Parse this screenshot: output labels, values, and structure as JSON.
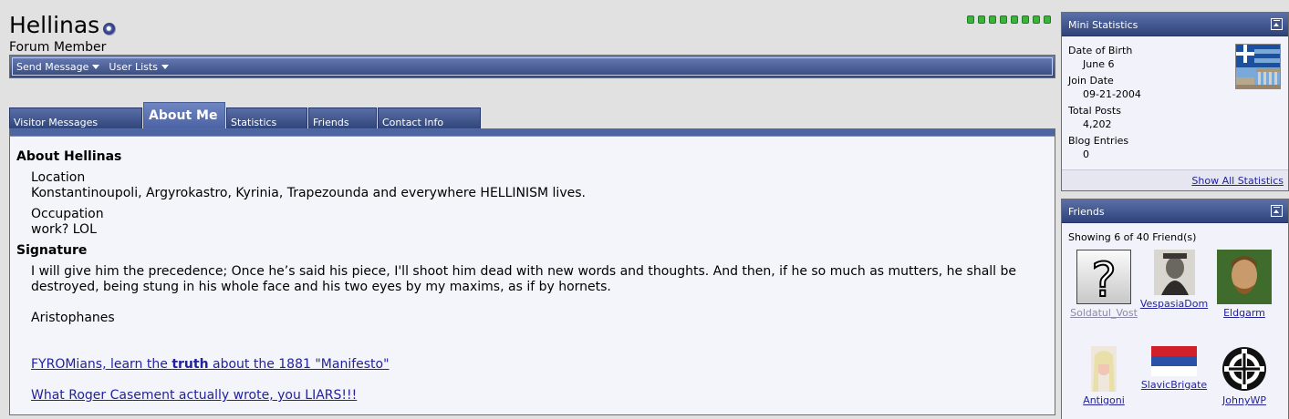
{
  "profile": {
    "username": "Hellinas",
    "usertitle": "Forum Member",
    "status_icon": "online-status-icon",
    "reputation_pips": 8
  },
  "actions": {
    "send_message": "Send Message",
    "user_lists": "User Lists"
  },
  "tabs": [
    "Visitor Messages",
    "About Me",
    "Statistics",
    "Friends",
    "Contact Info"
  ],
  "active_tab": "About Me",
  "about": {
    "title": "About Hellinas",
    "location_label": "Location",
    "location_value": "Konstantinoupoli, Argyrokastro, Kyrinia, Trapezounda and everywhere HELLINISM lives.",
    "occupation_label": "Occupation",
    "occupation_value": "work? LOL",
    "signature_title": "Signature",
    "signature_line1": "I will give him the precedence; Once he’s said his piece, I'll shoot him dead with new words and thoughts. And then, if he so much as mutters, he shall be",
    "signature_line2": "destroyed, being stung in his whole face and his two eyes by my maxims, as if by hornets.",
    "signature_author": "Aristophanes",
    "link1_before": "FYROMians, learn the ",
    "link1_bold": "truth",
    "link1_after": " about the 1881 \"Manifesto\"",
    "link2": "What Roger Casement actually wrote, you LIARS!!!"
  },
  "mini_statistics": {
    "title": "Mini Statistics",
    "dob_label": "Date of Birth",
    "dob_value": "June 6",
    "join_label": "Join Date",
    "join_value": "09-21-2004",
    "posts_label": "Total Posts",
    "posts_value": "4,202",
    "blog_label": "Blog Entries",
    "blog_value": "0",
    "show_all": "Show All Statistics"
  },
  "friends": {
    "title": "Friends",
    "showing": "Showing 6 of 40 Friend(s)",
    "list": [
      "Soldatul_Vost",
      "VespasiaDom",
      "Eldgarm",
      "Antigoni",
      "SlavicBrigate",
      "JohnyWP"
    ]
  },
  "colors": {
    "header_blue": "#34487e",
    "link": "#22229c",
    "rep_green": "#3cb33c"
  }
}
